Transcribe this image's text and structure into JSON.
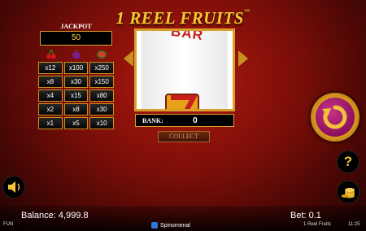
{
  "title": {
    "text": "1 REEL FRUITS",
    "tm": "™"
  },
  "jackpot": {
    "label": "JACKPOT",
    "value": "50"
  },
  "paytable": {
    "fruits": [
      "cherry-icon",
      "plum-icon",
      "watermelon-icon"
    ],
    "rows": [
      [
        "x12",
        "x100",
        "x250"
      ],
      [
        "x8",
        "x30",
        "x150"
      ],
      [
        "x4",
        "x15",
        "x80"
      ],
      [
        "x2",
        "x8",
        "x30"
      ],
      [
        "x1",
        "x5",
        "x10"
      ]
    ]
  },
  "reel": {
    "symbol_top": "BAR",
    "symbol_bottom": "7"
  },
  "bank": {
    "label": "BANK:",
    "value": "0"
  },
  "collect_label": "COLLECT",
  "help_label": "?",
  "footer": {
    "balance": "Balance: 4,999.8",
    "bet": "Bet: 0.1",
    "mode": "FUN",
    "provider": "Spinomenal",
    "game_name": "1 Reel Fruits",
    "clock": "11:25"
  },
  "colors": {
    "gold": "#d8a02a",
    "background": "#7a0e08",
    "spin_button": "#8e0f5e"
  }
}
